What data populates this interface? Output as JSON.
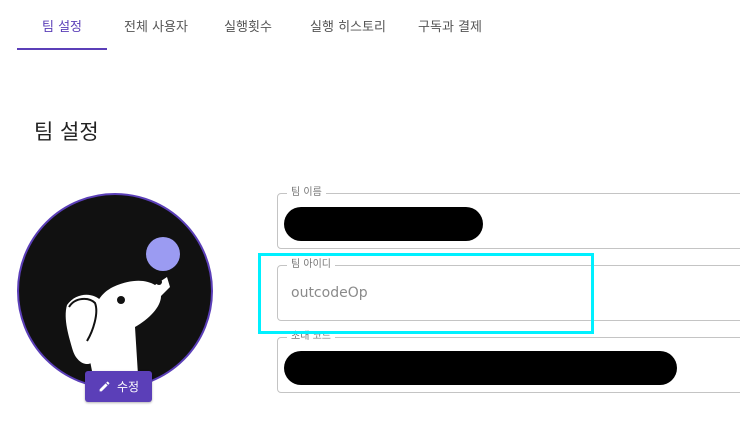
{
  "tabs": [
    {
      "label": "팀 설정",
      "active": true
    },
    {
      "label": "전체 사용자",
      "active": false
    },
    {
      "label": "실행횟수",
      "active": false
    },
    {
      "label": "실행 히스토리",
      "active": false
    },
    {
      "label": "구독과 결제",
      "active": false
    }
  ],
  "page_title": "팀 설정",
  "avatar": {
    "icon": "dog-balancing-ball-icon",
    "edit_label": "수정",
    "edit_icon": "pencil-icon"
  },
  "fields": {
    "team_name": {
      "label": "팀 이름",
      "value_redacted": true
    },
    "team_id": {
      "label": "팀 아이디",
      "value": "outcodeOp"
    },
    "invite_code": {
      "label": "초대 코드",
      "value_redacted": true
    }
  },
  "colors": {
    "accent": "#5b3fb8",
    "highlight": "#00f0ff",
    "avatar_bg": "#111111",
    "ball": "#9b9bf2"
  }
}
